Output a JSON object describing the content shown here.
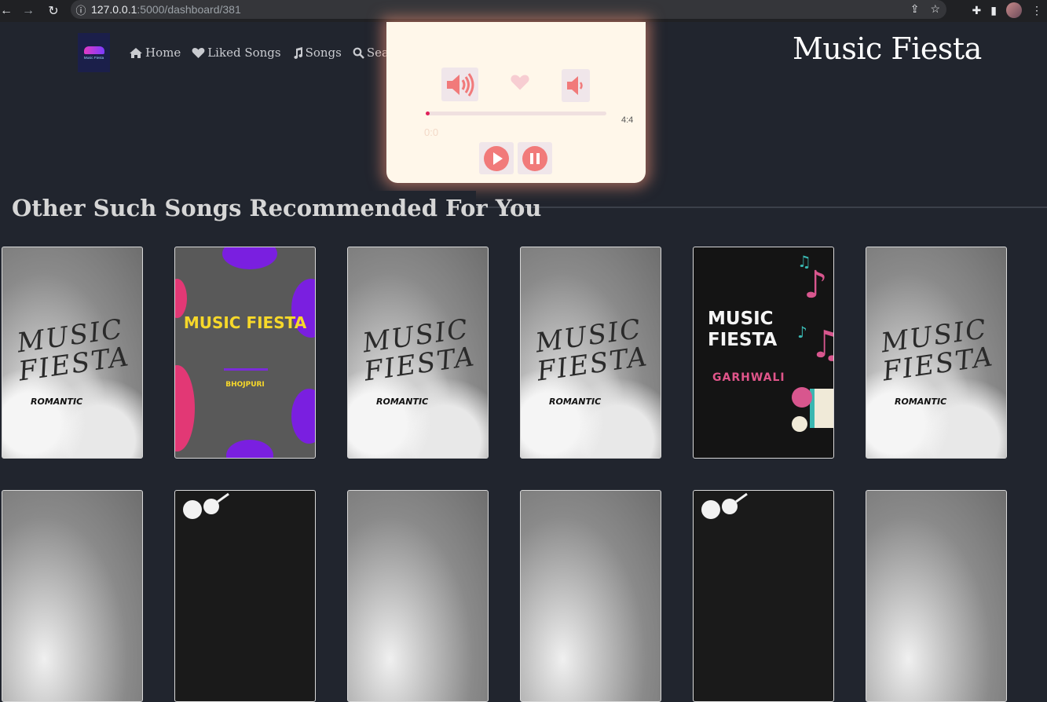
{
  "browser": {
    "url_host": "127.0.0.1",
    "url_path": ":5000/dashboard/381"
  },
  "nav": {
    "logo_text": "Music Fiesta",
    "links": [
      {
        "label": "Home",
        "icon": "home-icon"
      },
      {
        "label": "Liked Songs",
        "icon": "heart-icon"
      },
      {
        "label": "Songs",
        "icon": "music-note-icon"
      },
      {
        "label": "Search",
        "icon": "search-icon"
      }
    ]
  },
  "site_title": "Music Fiesta",
  "player": {
    "total_time": "4:4",
    "current_time": "0:0",
    "progress": 0.02,
    "liked": false
  },
  "section_title": "Other Such Songs Recommended For You",
  "cards": [
    {
      "type": "romantic",
      "title": "MUSIC FIESTA",
      "genre": "ROMANTIC"
    },
    {
      "type": "bhojpuri",
      "title": "MUSIC FIESTA",
      "genre": "BHOJPURI"
    },
    {
      "type": "romantic",
      "title": "MUSIC FIESTA",
      "genre": "ROMANTIC"
    },
    {
      "type": "romantic",
      "title": "MUSIC FIESTA",
      "genre": "ROMANTIC"
    },
    {
      "type": "garhwali",
      "title": "MUSIC FIESTA",
      "genre": "GARHWALI"
    },
    {
      "type": "romantic",
      "title": "MUSIC FIESTA",
      "genre": "ROMANTIC"
    }
  ],
  "colors": {
    "background": "#21252e",
    "player_bg": "#fff7ea",
    "accent": "#f17a7a",
    "progress": "#e0225a"
  }
}
